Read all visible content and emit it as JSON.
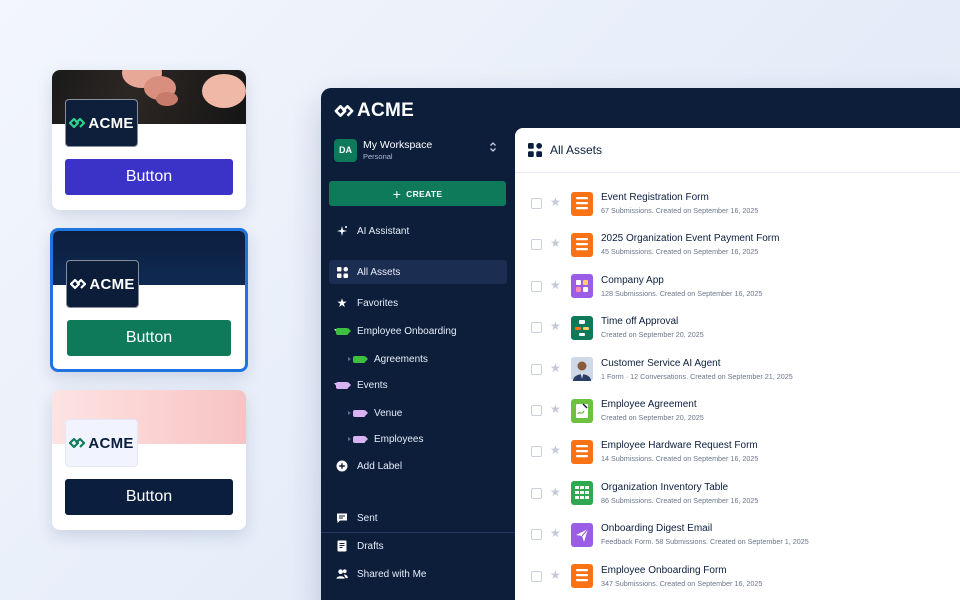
{
  "brand": {
    "name": "ACME"
  },
  "theme_cards": [
    {
      "button_label": "Button",
      "accent": "#3b33c8"
    },
    {
      "button_label": "Button",
      "accent": "#0e7a5a",
      "selected": true
    },
    {
      "button_label": "Button",
      "accent": "#0b1e3d"
    }
  ],
  "workspace": {
    "initials": "DA",
    "name": "My Workspace",
    "type": "Personal"
  },
  "sidebar": {
    "create_label": "CREATE",
    "ai_assistant": "AI Assistant",
    "all_assets": "All Assets",
    "favorites": "Favorites",
    "labels": [
      {
        "label": "Employee Onboarding",
        "color": "#3fbf42",
        "children": [
          "Agreements"
        ]
      },
      {
        "label": "Events",
        "color": "#d8b3f2",
        "children": [
          "Venue",
          "Employees"
        ]
      }
    ],
    "add_label": "Add Label",
    "bottom": [
      "Sent",
      "Drafts",
      "Shared with Me"
    ]
  },
  "main": {
    "title": "All Assets",
    "assets": [
      {
        "name": "Event Registration Form",
        "meta": "67 Submissions. Created on September 16, 2025",
        "icon": "form-icon",
        "color": "#f97316"
      },
      {
        "name": "2025 Organization Event Payment Form",
        "meta": "45 Submissions. Created on September 16, 2025",
        "icon": "form-icon",
        "color": "#f97316"
      },
      {
        "name": "Company App",
        "meta": "128 Submissions. Created on September 16, 2025",
        "icon": "app-icon",
        "color": "#9b5de5"
      },
      {
        "name": "Time off Approval",
        "meta": "Created on September 20, 2025",
        "icon": "workflow-icon",
        "color": "#0e7a5a"
      },
      {
        "name": "Customer Service AI Agent",
        "meta": "1 Form · 12 Conversations. Created on September 21, 2025",
        "icon": "agent-avatar-icon",
        "color": "#2b3f66"
      },
      {
        "name": "Employee Agreement",
        "meta": "Created on September 20, 2025",
        "icon": "sign-icon",
        "color": "#6cc13f"
      },
      {
        "name": "Employee Hardware Request Form",
        "meta": "14 Submissions. Created on September 16, 2025",
        "icon": "form-icon",
        "color": "#f97316"
      },
      {
        "name": "Organization Inventory Table",
        "meta": "86 Submissions. Created on September 16, 2025",
        "icon": "table-icon",
        "color": "#2fa84f"
      },
      {
        "name": "Onboarding Digest Email",
        "meta": "Feedback Form. 58 Submissions. Created on September 1, 2025",
        "icon": "email-icon",
        "color": "#9b5de5"
      },
      {
        "name": "Employee Onboarding Form",
        "meta": "347 Submissions. Created on September 16, 2025",
        "icon": "form-icon",
        "color": "#f97316"
      }
    ]
  }
}
